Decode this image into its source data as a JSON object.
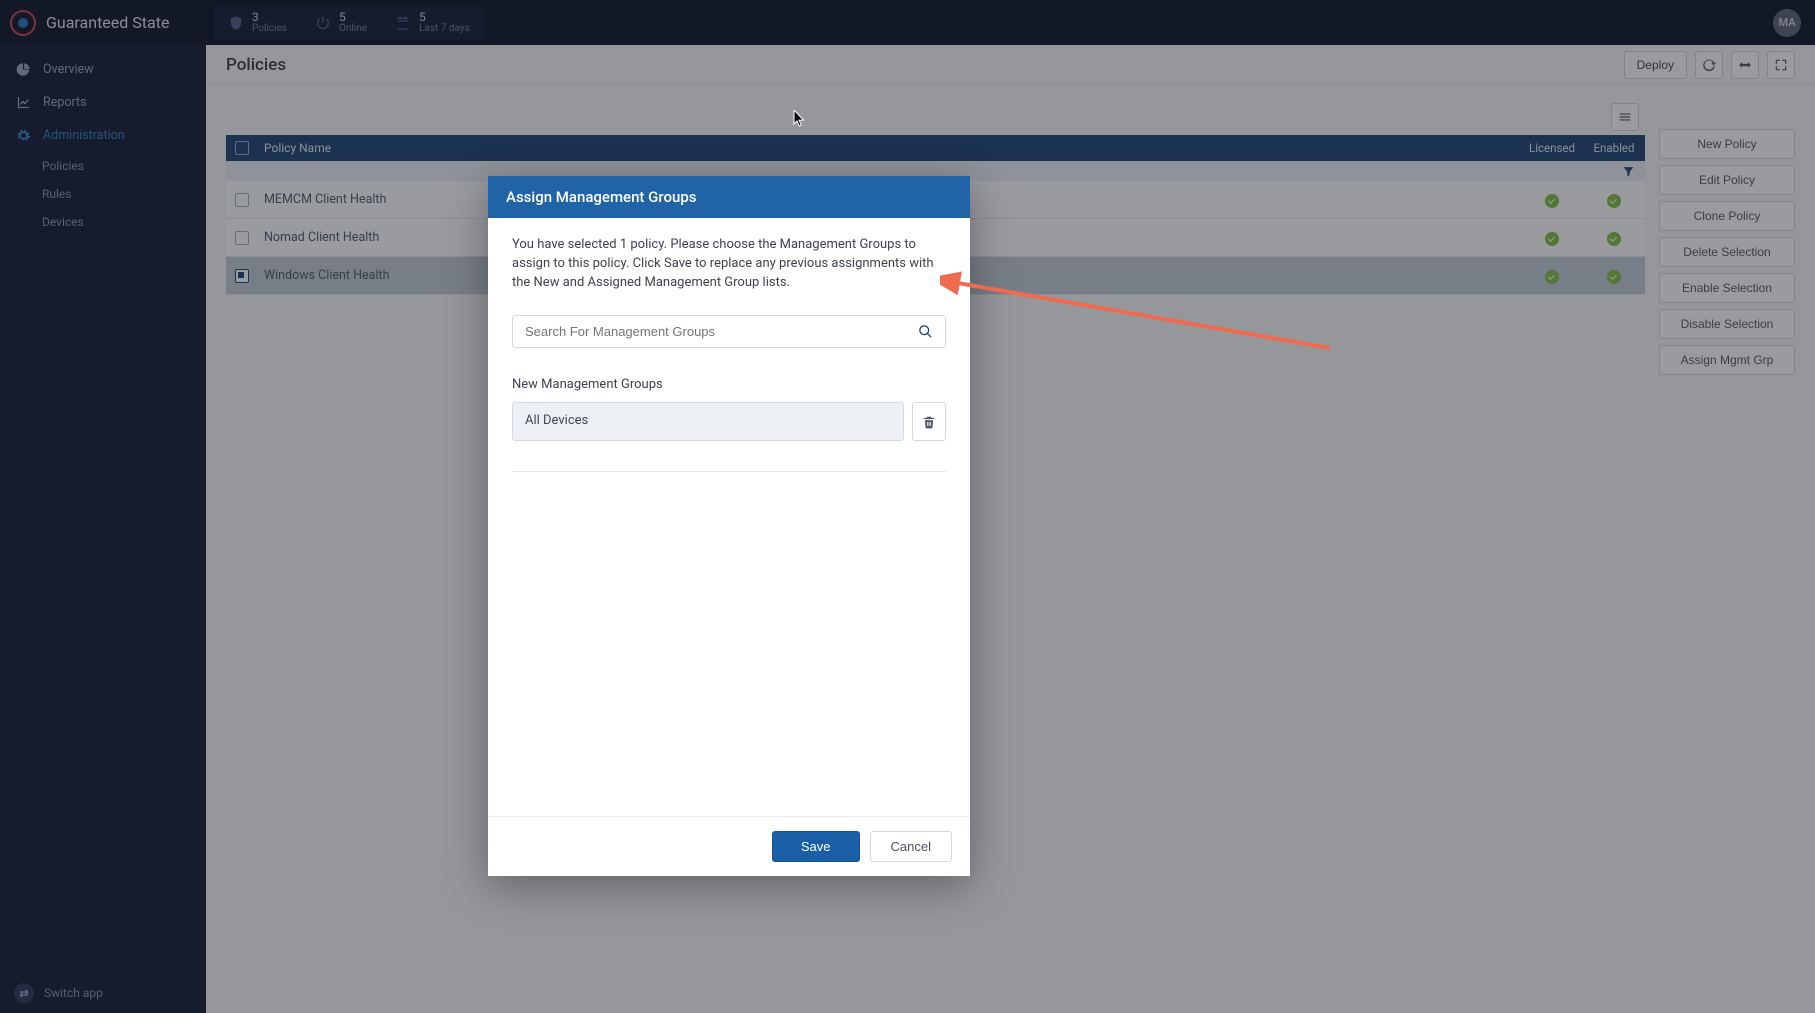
{
  "app": {
    "title": "Guaranteed State",
    "avatar": "MA",
    "switch": "Switch app"
  },
  "topStats": {
    "policies": {
      "value": "3",
      "label": "Policies"
    },
    "online": {
      "value": "5",
      "label": "Online"
    },
    "last": {
      "value": "5",
      "label": "Last 7 days"
    }
  },
  "nav": {
    "overview": "Overview",
    "reports": "Reports",
    "admin": "Administration",
    "sub": {
      "policies": "Policies",
      "rules": "Rules",
      "devices": "Devices"
    }
  },
  "page": {
    "title": "Policies",
    "deploy": "Deploy"
  },
  "table": {
    "headers": {
      "name": "Policy Name",
      "licensed": "Licensed",
      "enabled": "Enabled"
    },
    "rows": [
      {
        "name": "MEMCM Client Health",
        "selected": false
      },
      {
        "name": "Nomad Client Health",
        "selected": false
      },
      {
        "name": "Windows Client Health",
        "selected": true
      }
    ]
  },
  "actions": {
    "new": "New Policy",
    "edit": "Edit Policy",
    "clone": "Clone Policy",
    "delete": "Delete Selection",
    "enable": "Enable Selection",
    "disable": "Disable Selection",
    "assign": "Assign Mgmt Grp"
  },
  "modal": {
    "title": "Assign Management Groups",
    "desc": "You have selected 1 policy. Please choose the Management Groups to assign to this policy. Click Save to replace any previous assignments with the New and Assigned Management Group lists.",
    "searchPlaceholder": "Search For Management Groups",
    "newGroupsLabel": "New Management Groups",
    "group0": "All Devices",
    "save": "Save",
    "cancel": "Cancel"
  }
}
